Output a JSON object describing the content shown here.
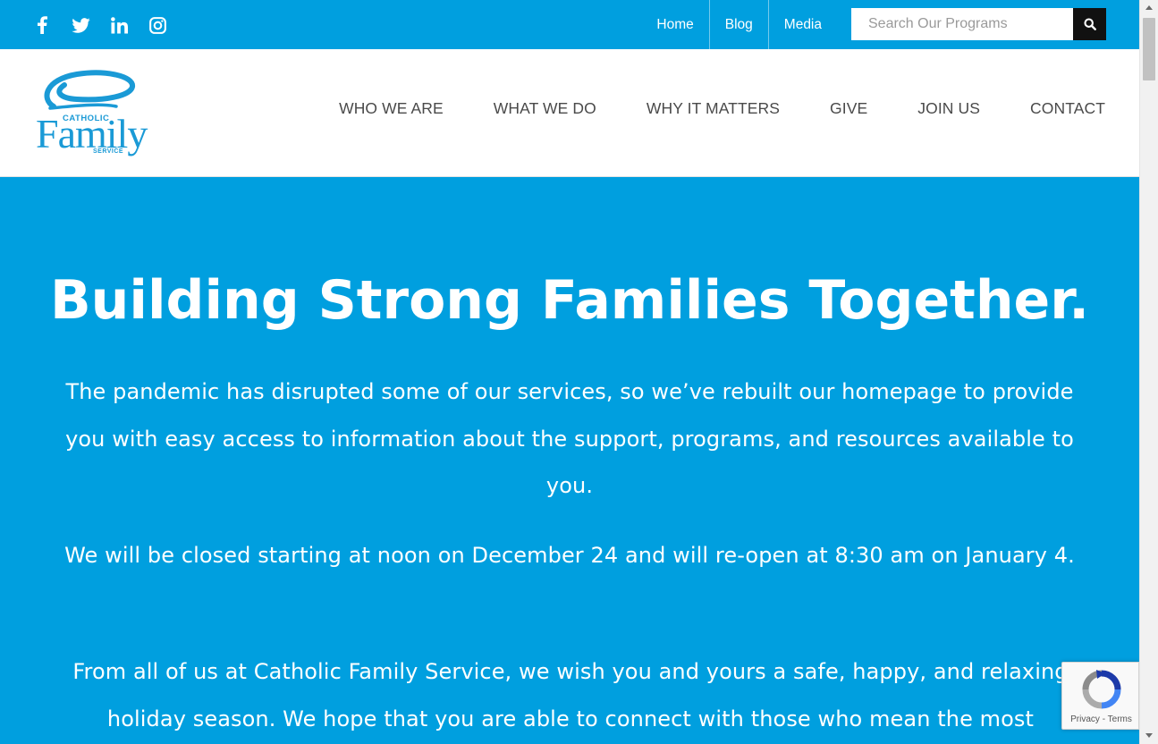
{
  "colors": {
    "brand_blue": "#009fdf",
    "logo_blue": "#1a9ad6",
    "nav_text": "#4a4a4a",
    "search_button": "#111111"
  },
  "topbar": {
    "social": [
      {
        "name": "facebook",
        "icon": "facebook-icon"
      },
      {
        "name": "twitter",
        "icon": "twitter-icon"
      },
      {
        "name": "linkedin",
        "icon": "linkedin-icon"
      },
      {
        "name": "instagram",
        "icon": "instagram-icon"
      }
    ],
    "links": [
      "Home",
      "Blog",
      "Media"
    ],
    "search": {
      "placeholder": "Search Our Programs",
      "value": "",
      "button_icon": "search-icon"
    }
  },
  "logo": {
    "line1": "CATHOLIC",
    "line2": "Family",
    "line3": "SERVICE"
  },
  "nav": {
    "items": [
      "WHO WE ARE",
      "WHAT WE DO",
      "WHY IT MATTERS",
      "GIVE",
      "JOIN US",
      "CONTACT"
    ]
  },
  "hero": {
    "title": "Building Strong Families Together.",
    "paragraphs": [
      "The pandemic has disrupted some of our services, so we’ve rebuilt our homepage to provide you with easy access to information about the support, programs, and resources available to you.",
      "We will be closed starting at noon on December 24 and will re-open at 8:30 am on January 4.",
      "From all of us at Catholic Family Service, we wish you and yours a safe, happy, and relaxing holiday season. We hope that you are able to connect with those who mean the most"
    ]
  },
  "recaptcha": {
    "privacy": "Privacy",
    "separator": " - ",
    "terms": "Terms"
  }
}
